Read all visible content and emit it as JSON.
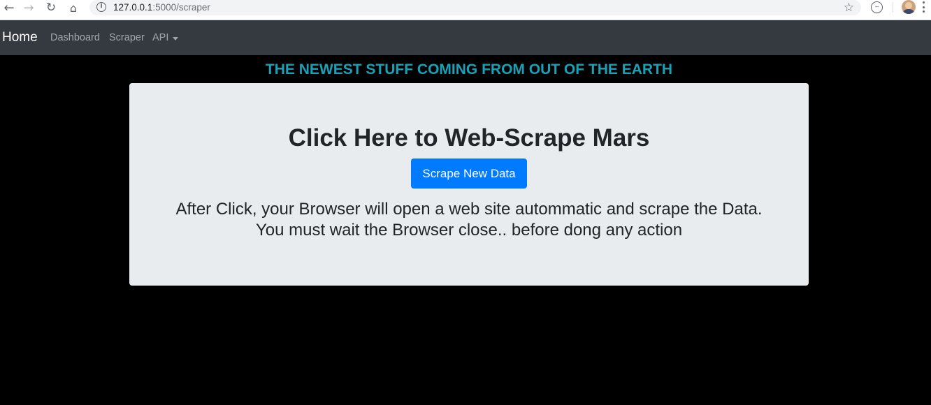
{
  "browser": {
    "url_host": "127.0.0.1",
    "url_rest": ":5000/scraper"
  },
  "navbar": {
    "brand": "Home",
    "links": [
      "Dashboard",
      "Scraper",
      "API"
    ]
  },
  "headline": "THE NEWEST STUFF COMING FROM OUT OF THE EARTH",
  "jumbotron": {
    "title": "Click Here to Web-Scrape Mars",
    "button_label": "Scrape New Data",
    "line1": "After Click, your Browser will open a web site autommatic and scrape the Data.",
    "line2": "You must wait the Browser close.. before dong any action"
  },
  "colors": {
    "navbar_bg": "#343a40",
    "headline": "#17a2b8",
    "jumbotron_bg": "#e9ecef",
    "primary_button": "#007bff",
    "page_bg": "#000000"
  },
  "icons": [
    "back-arrow-icon",
    "forward-arrow-icon",
    "reload-icon",
    "home-icon",
    "info-icon",
    "star-icon",
    "extension-icon",
    "avatar",
    "menu-kebab-icon",
    "caret-down-icon"
  ]
}
